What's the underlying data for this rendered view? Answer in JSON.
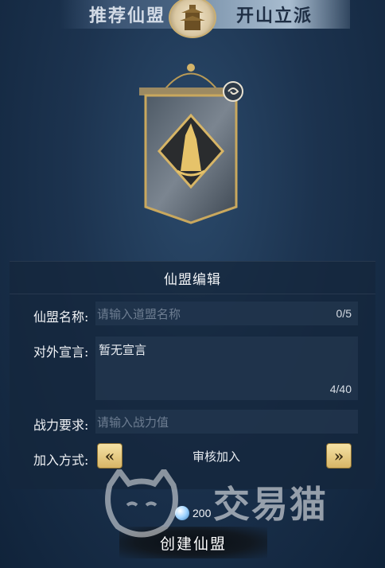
{
  "tabs": [
    {
      "label": "推荐仙盟"
    },
    {
      "label": "开山立派"
    }
  ],
  "panel": {
    "title": "仙盟编辑",
    "name_label": "仙盟名称:",
    "name_placeholder": "请输入道盟名称",
    "name_counter": "0/5",
    "declaration_label": "对外宣言:",
    "declaration_value": "暂无宣言",
    "declaration_counter": "4/40",
    "power_label": "战力要求:",
    "power_placeholder": "请输入战力值",
    "join_label": "加入方式:",
    "join_value": "审核加入",
    "prev_symbol": "«",
    "next_symbol": "»"
  },
  "cost": {
    "amount": "200",
    "icon": "spirit-stone-icon"
  },
  "create_button": "创建仙盟",
  "watermark": "交易猫",
  "colors": {
    "gold": "#d7b566",
    "panel": "#14263c",
    "background": "#1c334f"
  }
}
